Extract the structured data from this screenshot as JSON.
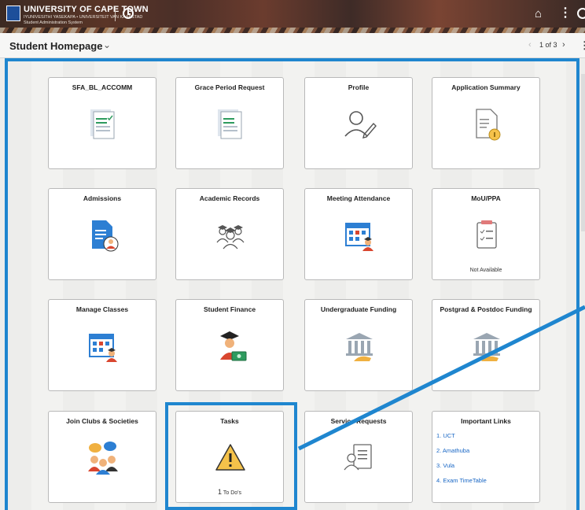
{
  "header": {
    "university": "UNIVERSITY OF CAPE TOWN",
    "sub_line1": "IYUNIVESITHI YASEKAPA • UNIVERSITEIT VAN KAAPSTAD",
    "sub_line2": "Student Administration System"
  },
  "titlebar": {
    "title": "Student Homepage",
    "pager": "1 of 3"
  },
  "tiles": [
    {
      "title": "SFA_BL_ACCOMM",
      "icon": "form-check-icon"
    },
    {
      "title": "Grace Period Request",
      "icon": "form-check-icon"
    },
    {
      "title": "Profile",
      "icon": "user-edit-icon"
    },
    {
      "title": "Application Summary",
      "icon": "document-info-icon"
    },
    {
      "title": "Admissions",
      "icon": "document-person-icon"
    },
    {
      "title": "Academic Records",
      "icon": "graduates-icon"
    },
    {
      "title": "Meeting Attendance",
      "icon": "calendar-person-icon"
    },
    {
      "title": "MoU/PPA",
      "icon": "clipboard-checklist-icon",
      "footer": "Not Available"
    },
    {
      "title": "Manage Classes",
      "icon": "calendar-person-icon"
    },
    {
      "title": "Student Finance",
      "icon": "graduate-money-icon"
    },
    {
      "title": "Undergraduate Funding",
      "icon": "bank-hand-icon"
    },
    {
      "title": "Postgrad & Postdoc Funding",
      "icon": "bank-hand-icon"
    },
    {
      "title": "Join Clubs & Societies",
      "icon": "people-chat-icon"
    },
    {
      "title": "Tasks",
      "icon": "warning-icon",
      "count": "1",
      "count_label": "To Do's"
    },
    {
      "title": "Service Requests",
      "icon": "person-document-icon"
    },
    {
      "title": "Important Links",
      "icon": "",
      "links": [
        "1. UCT",
        "2. Amathuba",
        "3. Vula",
        "4. Exam TimeTable"
      ]
    }
  ],
  "colors": {
    "accent": "#1f86cf",
    "link": "#1967c5"
  }
}
